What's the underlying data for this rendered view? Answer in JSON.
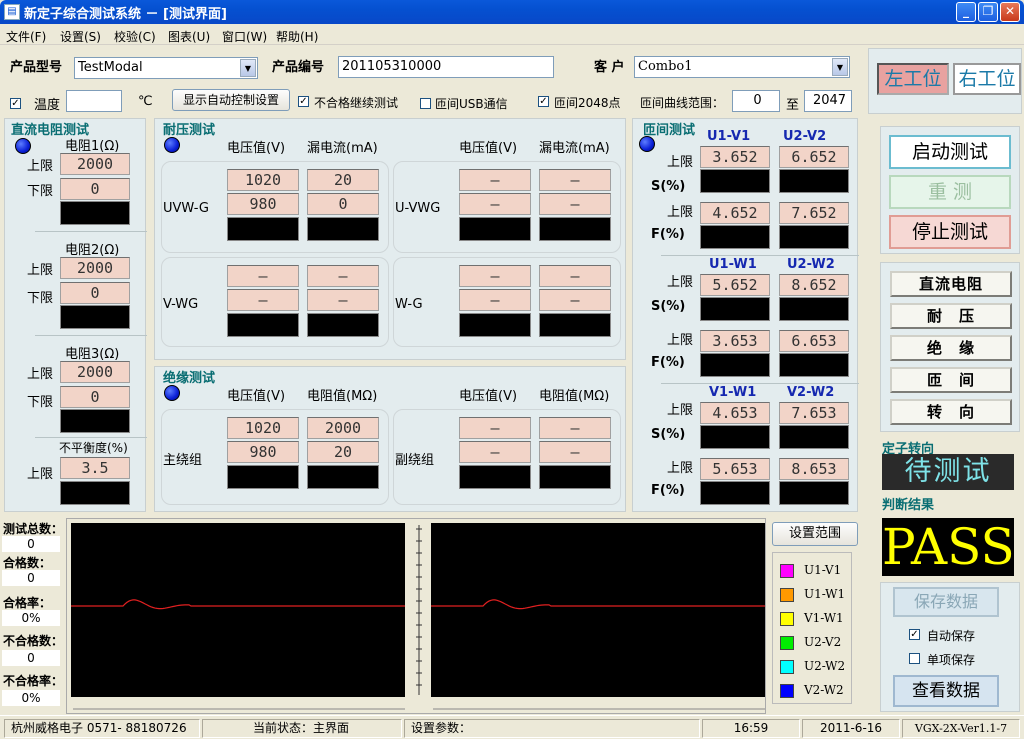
{
  "app": {
    "title": "新定子综合测试系统 － [测试界面]",
    "icon": "app-icon"
  },
  "menu": [
    "文件(F)",
    "设置(S)",
    "校验(C)",
    "图表(U)",
    "窗口(W)",
    "帮助(H)"
  ],
  "header": {
    "model_label": "产品型号",
    "model_value": "TestModal",
    "serial_label": "产品编号",
    "serial_value": "201105310000",
    "customer_label": "客 户",
    "customer_value": "Combo1",
    "temp_label": "温度",
    "temp_value": "",
    "temp_unit": "℃",
    "auto_ctrl_btn": "显示自动控制设置",
    "chk_continue": "不合格继续测试",
    "chk_usb": "匝间USB通信",
    "chk_2048": "匝间2048点",
    "range_label": "匝间曲线范围：",
    "range_from": "0",
    "range_to_label": "至",
    "range_to": "2047"
  },
  "station": {
    "left": "左工位",
    "right": "右工位"
  },
  "dc": {
    "title": "直流电阻测试",
    "upper": "上限",
    "lower": "下限",
    "r1": {
      "label": "电阻1(Ω)",
      "up": "2000",
      "low": "0"
    },
    "r2": {
      "label": "电阻2(Ω)",
      "up": "2000",
      "low": "0"
    },
    "r3": {
      "label": "电阻3(Ω)",
      "up": "2000",
      "low": "0"
    },
    "unb": {
      "label": "不平衡度(%)",
      "up": "3.5"
    }
  },
  "hipot": {
    "title": "耐压测试",
    "h_volt": "电压值(V)",
    "h_cur": "漏电流(mA)",
    "uvwg": {
      "name": "UVW-G",
      "v1": "1020",
      "c1": "20",
      "v2": "980",
      "c2": "0"
    },
    "uvwg2": {
      "name": "U-VWG",
      "v1": "—",
      "c1": "—",
      "v2": "—",
      "c2": "—"
    },
    "vwg": {
      "name": "V-WG",
      "v1": "—",
      "c1": "—",
      "v2": "—",
      "c2": "—"
    },
    "wg": {
      "name": "W-G",
      "v1": "—",
      "c1": "—",
      "v2": "—",
      "c2": "—"
    }
  },
  "insul": {
    "title": "绝缘测试",
    "h_volt": "电压值(V)",
    "h_res": "电阻值(MΩ)",
    "main": {
      "name": "主绕组",
      "v1": "1020",
      "r1": "2000",
      "v2": "980",
      "r2": "20"
    },
    "aux": {
      "name": "副绕组",
      "v1": "—",
      "r1": "—",
      "v2": "—",
      "r2": "—"
    }
  },
  "turn": {
    "title": "匝间测试",
    "upper": "上限",
    "s": "S(%)",
    "f": "F(%)",
    "u1v1": {
      "name": "U1-V1",
      "s": "3.652",
      "f": "4.652"
    },
    "u2v2": {
      "name": "U2-V2",
      "s": "6.652",
      "f": "7.652"
    },
    "u1w1": {
      "name": "U1-W1",
      "s": "5.652",
      "f": "3.653"
    },
    "u2w2": {
      "name": "U2-W2",
      "s": "8.652",
      "f": "6.653"
    },
    "v1w1": {
      "name": "V1-W1",
      "s": "4.653",
      "f": "5.653"
    },
    "v2w2": {
      "name": "V2-W2",
      "s": "7.653",
      "f": "8.653"
    }
  },
  "controls": {
    "start": "启动测试",
    "retest": "重 测",
    "stop": "停止测试",
    "tests": [
      "直流电阻",
      "耐　压",
      "绝　缘",
      "匝　间",
      "转　向"
    ],
    "rot_label": "定子转向",
    "rot_value": "待测试",
    "result_label": "判断结果",
    "result_value": "PASS",
    "save": "保存数据",
    "auto_save": "自动保存",
    "single_save": "单项保存",
    "view": "查看数据"
  },
  "stats": {
    "total_label": "测试总数：",
    "total": "0",
    "pass_label": "合格数：",
    "pass": "0",
    "rate_label": "合格率：",
    "rate": "0%",
    "fail_label": "不合格数：",
    "fail": "0",
    "frate_label": "不合格率：",
    "frate": "0%"
  },
  "wave": {
    "set_range": "设置范围",
    "legend": [
      {
        "name": "U1-V1",
        "color": "#FF00FF"
      },
      {
        "name": "U1-W1",
        "color": "#FF9900"
      },
      {
        "name": "V1-W1",
        "color": "#FFFF00"
      },
      {
        "name": "U2-V2",
        "color": "#00EE00"
      },
      {
        "name": "U2-W2",
        "color": "#00FFFF"
      },
      {
        "name": "V2-W2",
        "color": "#0000FF"
      }
    ],
    "trace_color": "#E02020"
  },
  "status": {
    "company": "杭州威格电子  0571- 88180726",
    "state": "当前状态：主界面",
    "params": "设置参数：",
    "time": "16:59",
    "date": "2011-6-16",
    "version": "VGX-2X-Ver1.1-7"
  },
  "colors": {
    "accent": "#0A6E73",
    "value_bg": "#F2D4C8",
    "panel": "#E3ECEE",
    "pass": "#FFFF00"
  }
}
